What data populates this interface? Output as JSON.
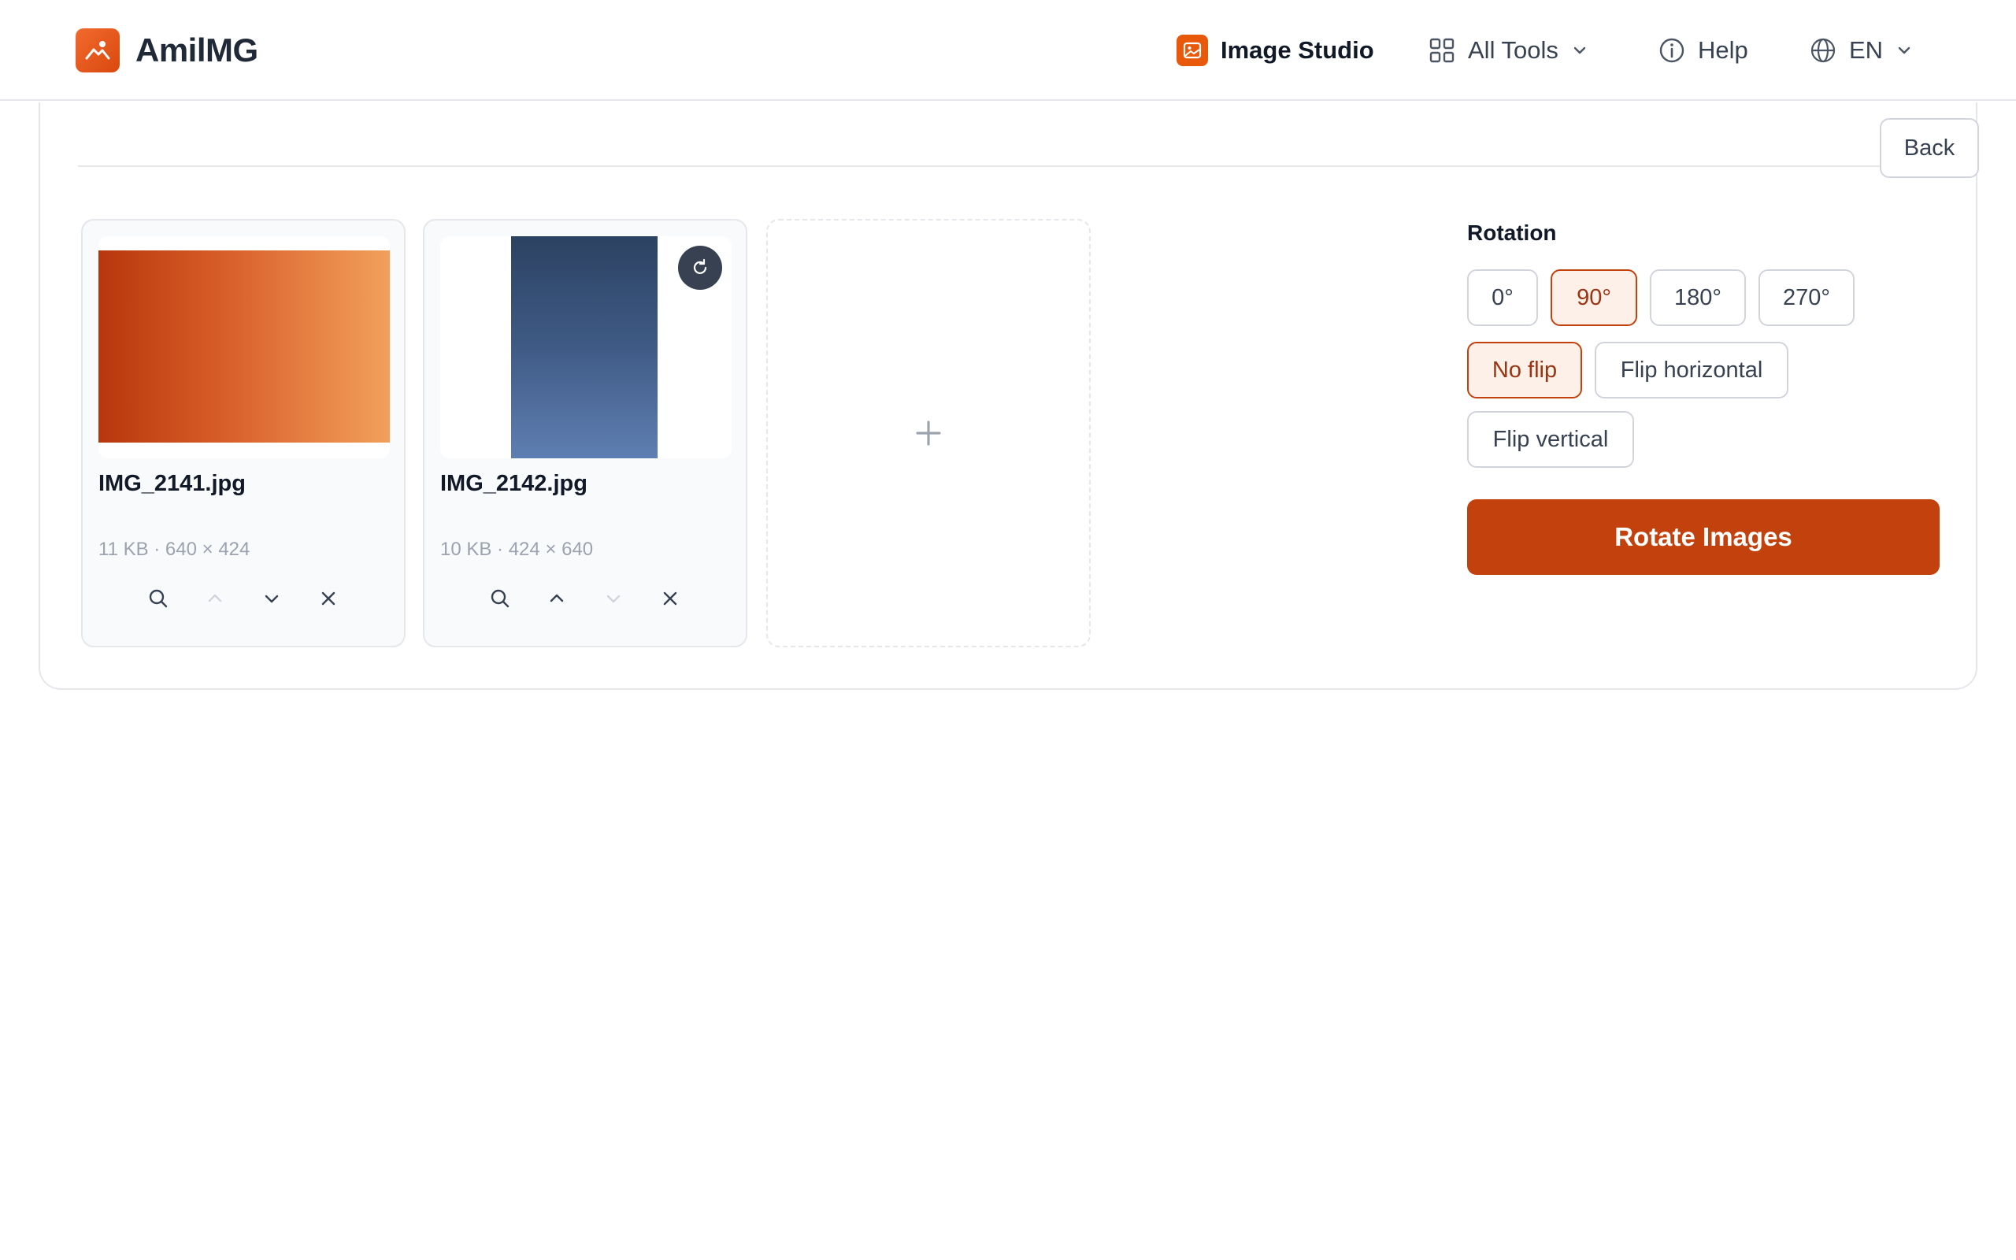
{
  "header": {
    "brand": "AmilMG",
    "nav": {
      "studio": "Image Studio",
      "tools": "All Tools",
      "help": "Help",
      "lang": "EN"
    }
  },
  "panel": {
    "back_label": "Back",
    "files": [
      {
        "name": "IMG_2141.jpg",
        "meta": "11 KB · 640 × 424"
      },
      {
        "name": "IMG_2142.jpg",
        "meta": "10 KB · 424 × 640"
      }
    ],
    "add_label": "+",
    "controls": {
      "rotation_label": "Rotation",
      "rotation_options": [
        "0°",
        "90°",
        "180°",
        "270°"
      ],
      "rotation_selected": "90°",
      "flip_options": [
        "No flip",
        "Flip horizontal",
        "Flip vertical"
      ],
      "flip_selected": "No flip",
      "submit_label": "Rotate Images"
    }
  },
  "colors": {
    "accent": "#c2410c",
    "accent_bg": "#fdf0e8",
    "brand": "#e8590c"
  }
}
